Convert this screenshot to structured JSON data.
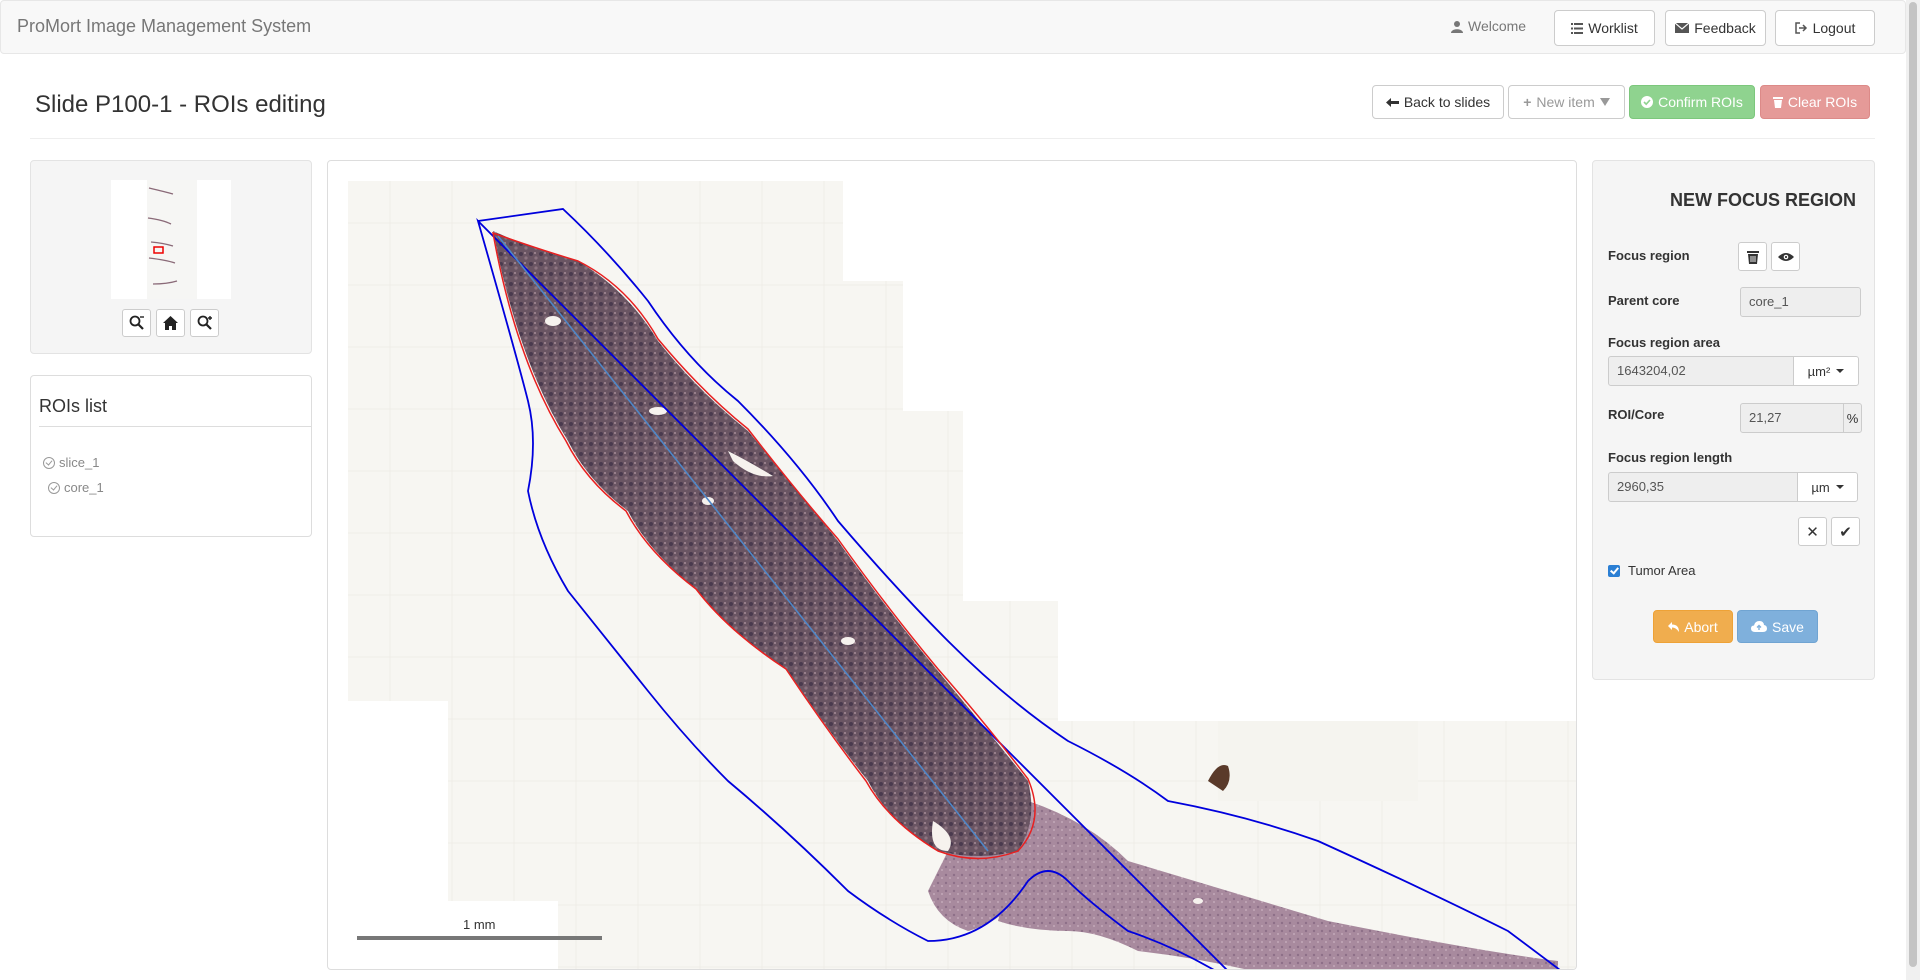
{
  "navbar": {
    "brand": "ProMort Image Management System",
    "welcome": "Welcome",
    "worklist": "Worklist",
    "feedback": "Feedback",
    "logout": "Logout"
  },
  "header": {
    "title": "Slide P100-1 - ROIs editing",
    "back_to_slides": "Back to slides",
    "new_item": "New item",
    "confirm_rois": "Confirm ROIs",
    "clear_rois": "Clear ROIs"
  },
  "rois_list": {
    "title": "ROIs list",
    "items": [
      "slice_1",
      "core_1"
    ]
  },
  "viewer": {
    "scale_label": "1 mm"
  },
  "form": {
    "title": "NEW FOCUS REGION",
    "focus_region_label": "Focus region",
    "parent_core_label": "Parent core",
    "parent_core_value": "core_1",
    "area_label": "Focus region area",
    "area_value": "1643204,02",
    "area_unit": "µm²",
    "roi_core_label": "ROI/Core",
    "roi_core_value": "21,27",
    "roi_core_unit": "%",
    "length_label": "Focus region length",
    "length_value": "2960,35",
    "length_unit": "µm",
    "tumor_area_label": "Tumor Area",
    "tumor_area_checked": true,
    "abort": "Abort",
    "save": "Save"
  },
  "colors": {
    "success_disabled": "#8fd38f",
    "danger_disabled": "#e59a98",
    "warning": "#f0ad4e",
    "info_disabled": "#7fb0dc",
    "roi_blue": "#0000dd",
    "roi_red": "#e82020"
  }
}
